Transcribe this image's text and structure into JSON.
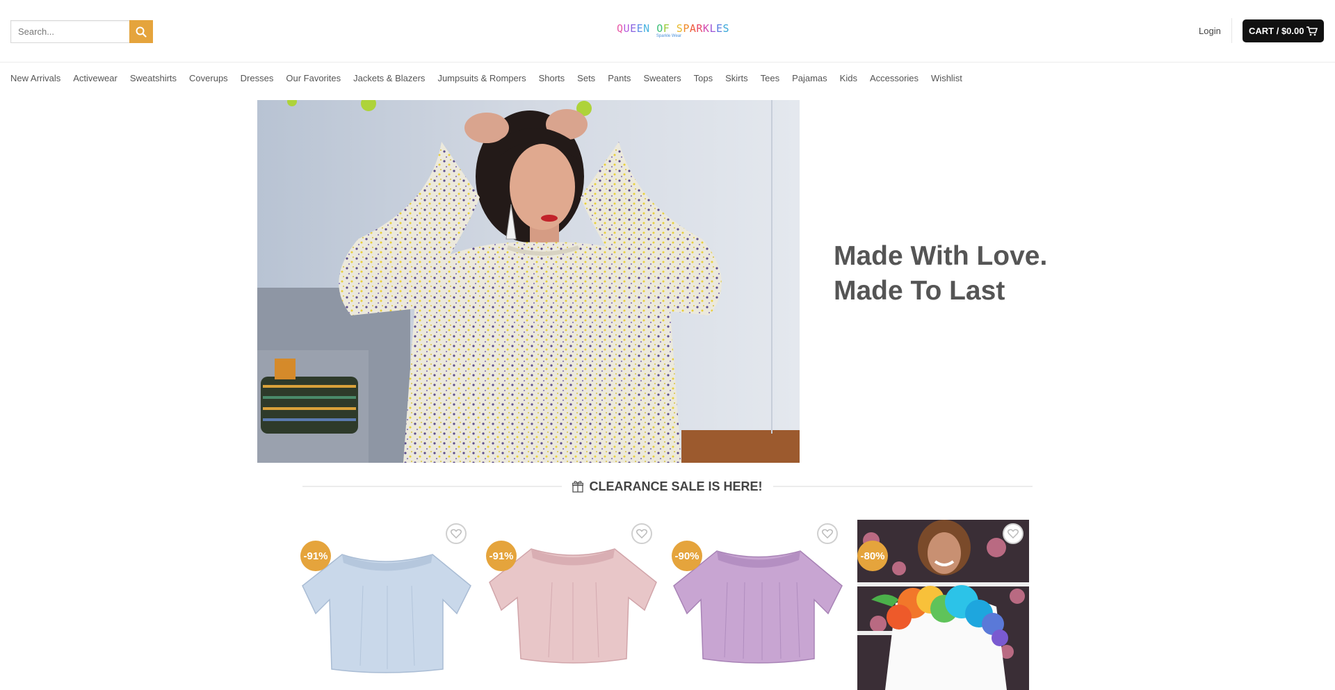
{
  "header": {
    "search_placeholder": "Search...",
    "logo_text": "QUEEN OF SPARKLES",
    "logo_subtext": "Sparkle Wear",
    "login_label": "Login",
    "cart_label": "CART / $0.00",
    "accent_color": "#e5a43c"
  },
  "nav": {
    "items": [
      "New Arrivals",
      "Activewear",
      "Sweatshirts",
      "Coverups",
      "Dresses",
      "Our Favorites",
      "Jackets & Blazers",
      "Jumpsuits & Rompers",
      "Shorts",
      "Sets",
      "Pants",
      "Sweaters",
      "Tops",
      "Skirts",
      "Tees",
      "Pajamas",
      "Kids",
      "Accessories",
      "Wishlist"
    ]
  },
  "hero": {
    "line1": "Made With Love.",
    "line2": "Made To Last"
  },
  "section": {
    "title": "CLEARANCE SALE IS HERE!",
    "icon": "gift-icon"
  },
  "products": [
    {
      "discount": "-91%",
      "color": "#c6d7ea"
    },
    {
      "discount": "-91%",
      "color": "#e6c3c6"
    },
    {
      "discount": "-90%",
      "color": "#c6a4cf"
    },
    {
      "discount": "-80%",
      "color": "#ffffff"
    }
  ]
}
